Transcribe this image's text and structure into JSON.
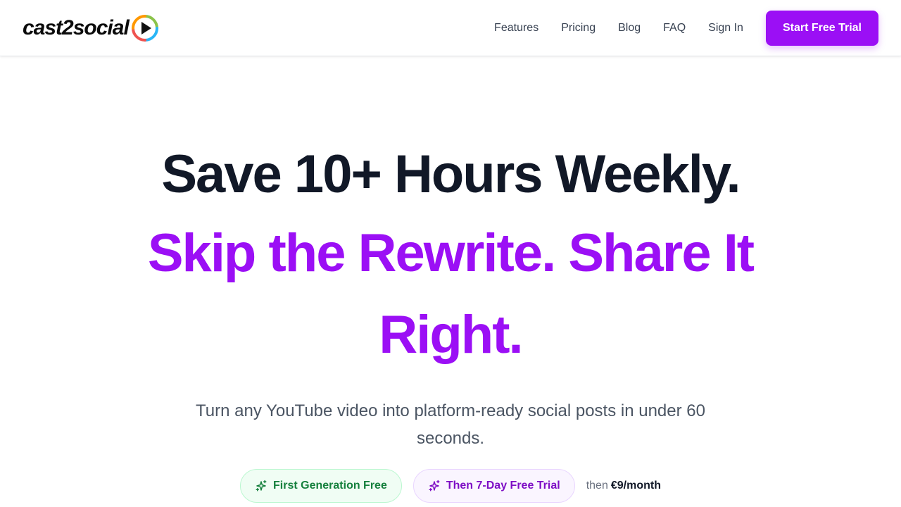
{
  "brand": {
    "name": "cast2social",
    "accent_color": "#9b0ff5"
  },
  "nav": {
    "links": [
      {
        "label": "Features"
      },
      {
        "label": "Pricing"
      },
      {
        "label": "Blog"
      },
      {
        "label": "FAQ"
      },
      {
        "label": "Sign In"
      }
    ],
    "cta_label": "Start Free Trial"
  },
  "hero": {
    "headline": "Save 10+ Hours Weekly.",
    "subheadline": "Skip the Rewrite. Share It Right.",
    "lede": "Turn any YouTube video into platform-ready social posts in under 60 seconds.",
    "pills": [
      {
        "label": "First Generation Free",
        "icon": "sparkles-icon",
        "color": "#15803d"
      },
      {
        "label": "Then 7-Day Free Trial",
        "icon": "sparkles-icon",
        "color": "#7e0ec5"
      }
    ],
    "price_prefix": "then",
    "price_amount": "€9/month"
  }
}
